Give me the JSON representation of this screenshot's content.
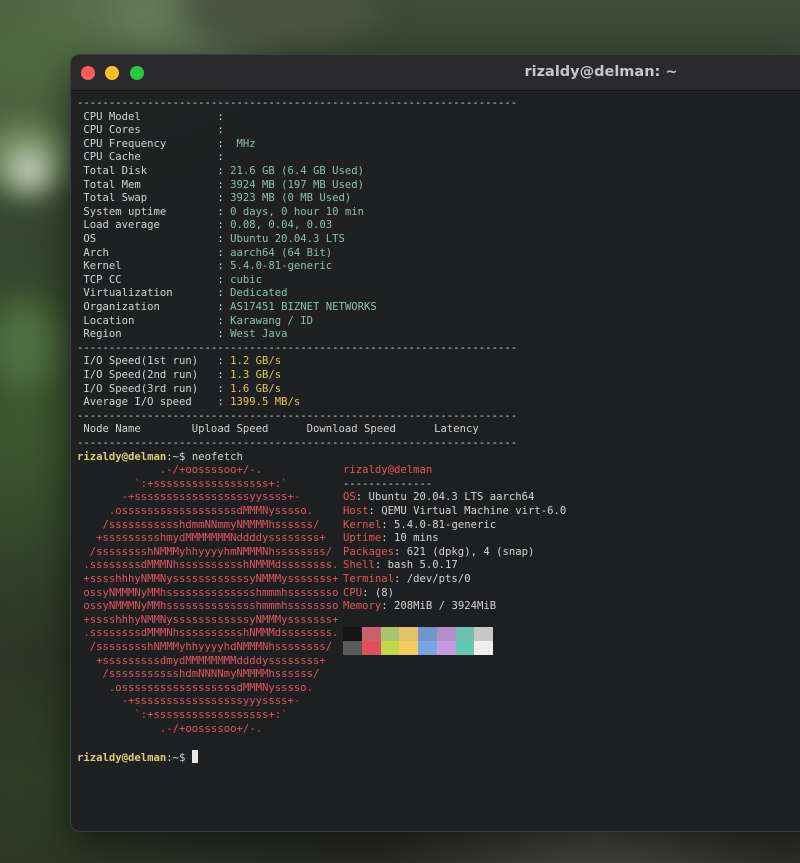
{
  "window": {
    "title": "rizaldy@delman: ~"
  },
  "terminal": {
    "separator": "---------------------------------------------------------------------",
    "sysinfo": [
      {
        "key": " CPU Model            ",
        "value": ""
      },
      {
        "key": " CPU Cores            ",
        "value": ""
      },
      {
        "key": " CPU Frequency        ",
        "value": " MHz"
      },
      {
        "key": " CPU Cache            ",
        "value": ""
      },
      {
        "key": " Total Disk           ",
        "value": "21.6 GB (6.4 GB Used)"
      },
      {
        "key": " Total Mem            ",
        "value": "3924 MB (197 MB Used)"
      },
      {
        "key": " Total Swap           ",
        "value": "3923 MB (0 MB Used)"
      },
      {
        "key": " System uptime        ",
        "value": "0 days, 0 hour 10 min"
      },
      {
        "key": " Load average         ",
        "value": "0.08, 0.04, 0.03"
      },
      {
        "key": " OS                   ",
        "value": "Ubuntu 20.04.3 LTS"
      },
      {
        "key": " Arch                 ",
        "value": "aarch64 (64 Bit)"
      },
      {
        "key": " Kernel               ",
        "value": "5.4.0-81-generic"
      },
      {
        "key": " TCP CC               ",
        "value": "cubic"
      },
      {
        "key": " Virtualization       ",
        "value": "Dedicated"
      },
      {
        "key": " Organization         ",
        "value": "AS17451 BIZNET NETWORKS"
      },
      {
        "key": " Location             ",
        "value": "Karawang / ID"
      },
      {
        "key": " Region               ",
        "value": "West Java"
      }
    ],
    "io": [
      {
        "key": " I/O Speed(1st run)   ",
        "value": "1.2 GB/s"
      },
      {
        "key": " I/O Speed(2nd run)   ",
        "value": "1.3 GB/s"
      },
      {
        "key": " I/O Speed(3rd run)   ",
        "value": "1.6 GB/s"
      },
      {
        "key": " Average I/O speed    ",
        "value": "1399.5 MB/s"
      }
    ],
    "speed_header": " Node Name        Upload Speed      Download Speed      Latency",
    "prompt_user": "rizaldy@delman",
    "prompt_path": ":~$ ",
    "command": "neofetch",
    "logo": [
      "             .-/+oossssoo+/-.",
      "         `:+ssssssssssssssssss+:`",
      "       -+ssssssssssssssssssyyssss+-",
      "     .ossssssssssssssssssdMMMNysssso.",
      "    /ssssssssssshdmmNNmmyNMMMMhssssss/",
      "   +ssssssssshmydMMMMMMMNddddyssssssss+",
      "  /sssssssshNMMMyhhyyyyhmNMMMNhssssssss/",
      " .ssssssssdMMMNhsssssssssshNMMMdssssssss.",
      " +sssshhhyNMMNyssssssssssssyNMMMysssssss+",
      " ossyNMMMNyMMhsssssssssssssshmmmhssssssso",
      " ossyNMMMNyMMhsssssssssssssshmmmhssssssso",
      " +sssshhhyNMMNyssssssssssssyNMMMysssssss+",
      " .ssssssssdMMMNhsssssssssshNMMMdssssssss.",
      "  /sssssssshNMMMyhhyyyyhdNMMMNhssssssss/",
      "   +sssssssssdmydMMMMMMMMddddyssssssss+",
      "    /ssssssssssshdmNNNNmyNMMMMhssssss/",
      "     .ossssssssssssssssssdMMMNysssso.",
      "       -+sssssssssssssssssyyyssss+-",
      "         `:+ssssssssssssssssss+:`",
      "             .-/+oossssoo+/-."
    ],
    "neofetch_header": "rizaldy@delman",
    "neofetch_rule": "--------------",
    "neofetch_info": [
      {
        "label": "OS",
        "value": ": Ubuntu 20.04.3 LTS aarch64"
      },
      {
        "label": "Host",
        "value": ": QEMU Virtual Machine virt-6.0"
      },
      {
        "label": "Kernel",
        "value": ": 5.4.0-81-generic"
      },
      {
        "label": "Uptime",
        "value": ": 10 mins"
      },
      {
        "label": "Packages",
        "value": ": 621 (dpkg), 4 (snap)"
      },
      {
        "label": "Shell",
        "value": ": bash 5.0.17"
      },
      {
        "label": "Terminal",
        "value": ": /dev/pts/0"
      },
      {
        "label": "CPU",
        "value": ": (8)"
      },
      {
        "label": "Memory",
        "value": ": 208MiB / 3924MiB"
      }
    ],
    "palette_top": [
      "#151515",
      "#c9626c",
      "#a9c46e",
      "#e4c26a",
      "#6f97c8",
      "#b48ec8",
      "#6dbfb0",
      "#c8c8c8"
    ],
    "palette_bottom": [
      "#5a5a5a",
      "#e0505c",
      "#c2d84a",
      "#f2cc5c",
      "#7aa6e0",
      "#c89ae0",
      "#62c8b2",
      "#eeeeee"
    ]
  }
}
